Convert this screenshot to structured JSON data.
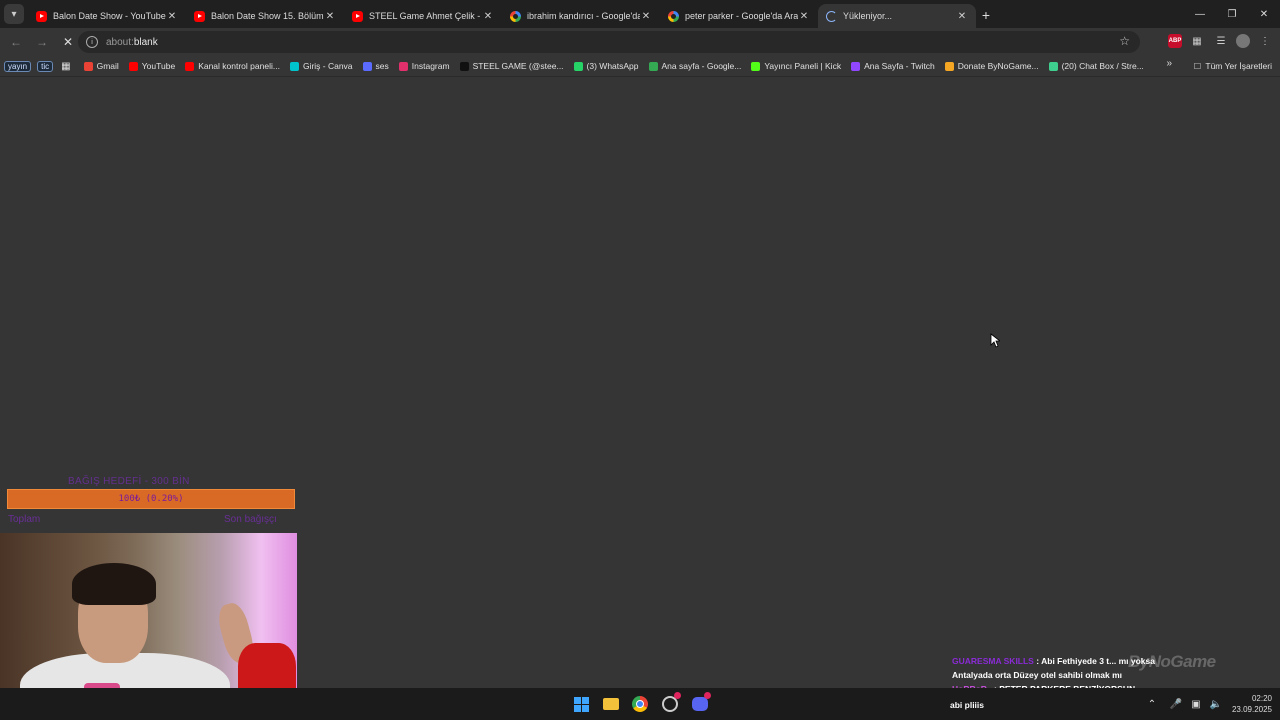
{
  "browser": {
    "tabs": [
      {
        "title": "Balon Date Show - YouTube",
        "icon": "youtube-icon"
      },
      {
        "title": "Balon Date Show 15. Bölüm - Yo",
        "icon": "youtube-icon"
      },
      {
        "title": "STEEL Game Ahmet Çelik - You",
        "icon": "youtube-icon"
      },
      {
        "title": "ibrahim kandırıcı - Google'da Ar",
        "icon": "google-icon"
      },
      {
        "title": "peter parker - Google'da Ara",
        "icon": "google-icon"
      },
      {
        "title": "Yükleniyor...",
        "icon": "loading-spinner-icon"
      }
    ],
    "active_tab": 5,
    "address": {
      "prefix": "about:",
      "main": "blank"
    },
    "bookmarks": [
      {
        "label": "Gmail",
        "icon": "gmail-icon",
        "color": "#ea4335"
      },
      {
        "label": "YouTube",
        "icon": "youtube-icon",
        "color": "#ff0000"
      },
      {
        "label": "Kanal kontrol paneli...",
        "icon": "youtube-studio-icon",
        "color": "#ff0000"
      },
      {
        "label": "Giriş - Canva",
        "icon": "canva-icon",
        "color": "#00c4cc"
      },
      {
        "label": "ses",
        "icon": "sound-icon",
        "color": "#5b6bff"
      },
      {
        "label": "Instagram",
        "icon": "instagram-icon",
        "color": "#e1306c"
      },
      {
        "label": "STEEL GAME (@stee...",
        "icon": "tiktok-icon",
        "color": "#111111"
      },
      {
        "label": "(3) WhatsApp",
        "icon": "whatsapp-icon",
        "color": "#25d366"
      },
      {
        "label": "Ana sayfa - Google...",
        "icon": "google-drive-icon",
        "color": "#34a853"
      },
      {
        "label": "Yayıncı Paneli | Kick",
        "icon": "kick-icon",
        "color": "#53fc18"
      },
      {
        "label": "Ana Sayfa - Twitch",
        "icon": "twitch-icon",
        "color": "#9146ff"
      },
      {
        "label": "Donate ByNoGame...",
        "icon": "bynogame-icon",
        "color": "#f5a623"
      },
      {
        "label": "(20) Chat Box / Stre...",
        "icon": "chatbox-icon",
        "color": "#3ecf8e"
      }
    ],
    "bookmark_badges": [
      "yayın",
      "tic"
    ],
    "all_bookmarks": "Tüm Yer İşaretleri"
  },
  "stream_overlay": {
    "goal_header": "BAĞIŞ HEDEFİ - 300 BİN",
    "goal_progress_text": "100₺ (0.20%)",
    "goal_progress_fraction": 0.002,
    "goal_left": "Toplam",
    "goal_right": "Son bağışçı",
    "watermark": "ByNoGame"
  },
  "chat": [
    {
      "user": "GUARESMA SKILLS",
      "message": ": Abi Fethiyede 3 t... mı yoksa"
    },
    {
      "user": "",
      "message": "Antalyada orta Düzey otel sahibi olmak mı"
    },
    {
      "user": "HoRRoR_",
      "message": ": PETER PARKERE BENZİYORSUN"
    },
    {
      "user": "",
      "message": "abi pliiis"
    }
  ],
  "taskbar": {
    "time": "02:20",
    "date": "23.09.2025"
  }
}
